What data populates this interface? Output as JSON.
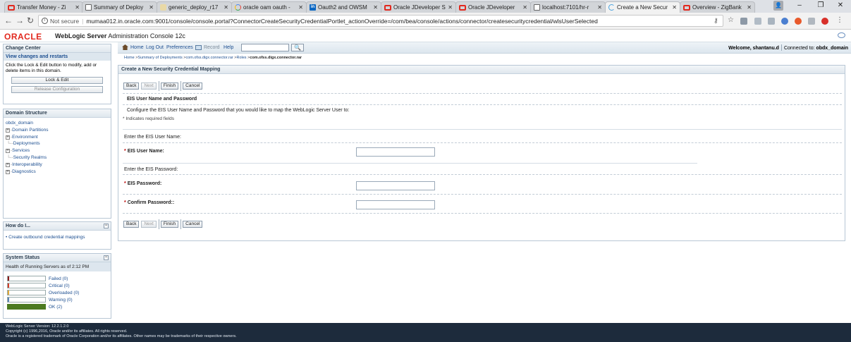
{
  "browser": {
    "tabs": [
      {
        "title": "Transfer Money - Zi",
        "icon": "oracle-icon"
      },
      {
        "title": "Summary of Deploy",
        "icon": "document-icon"
      },
      {
        "title": "generic_deploy_r17",
        "icon": "face-icon"
      },
      {
        "title": "oracle oam oauth -",
        "icon": "google-icon"
      },
      {
        "title": "Oauth2 and OWSM",
        "icon": "linkedin-icon"
      },
      {
        "title": "Oracle JDeveloper S",
        "icon": "oracle-icon"
      },
      {
        "title": "Oracle JDeveloper",
        "icon": "oracle-icon"
      },
      {
        "title": "localhost:7101/hr-r",
        "icon": "document-icon"
      },
      {
        "title": "Create a New Secur",
        "icon": "loading-icon"
      },
      {
        "title": "Overview - ZigBank",
        "icon": "oracle-icon"
      }
    ],
    "security": "Not secure",
    "url": "mumaa012.in.oracle.com:9001/console/console.portal?ConnectorCreateSecurityCredentialPortlet_actionOverride=/com/bea/console/actions/connector/createsecuritycredential/wlsUserSelected"
  },
  "header": {
    "logo": "ORACLE",
    "product": "WebLogic Server",
    "subtitle": "Administration Console 12c"
  },
  "change_center": {
    "title": "Change Center",
    "subtitle": "View changes and restarts",
    "text": "Click the Lock & Edit button to modify, add or delete items in this domain.",
    "lock_edit": "Lock & Edit",
    "release": "Release Configuration"
  },
  "domain_structure": {
    "title": "Domain Structure",
    "root": "obdx_domain",
    "items": [
      {
        "prefix": "⊞",
        "label": "Domain Partitions"
      },
      {
        "prefix": "⊞",
        "label": "Environment"
      },
      {
        "prefix": "",
        "label": "Deployments"
      },
      {
        "prefix": "⊞",
        "label": "Services"
      },
      {
        "prefix": "",
        "label": "Security Realms"
      },
      {
        "prefix": "⊞",
        "label": "Interoperability"
      },
      {
        "prefix": "⊞",
        "label": "Diagnostics"
      }
    ]
  },
  "how_do_i": {
    "title": "How do I...",
    "link": "Create outbound credential mappings"
  },
  "system_status": {
    "title": "System Status",
    "subtitle": "Health of Running Servers as of  2:12 PM",
    "rows": [
      {
        "label": "Failed (0)",
        "color": "#8b1a1a",
        "fill": 0
      },
      {
        "label": "Critical (0)",
        "color": "#d23d2a",
        "fill": 0
      },
      {
        "label": "Overloaded (0)",
        "color": "#e0a83a",
        "fill": 0
      },
      {
        "label": "Warning (0)",
        "color": "#5a83b5",
        "fill": 0
      },
      {
        "label": "OK (2)",
        "color": "#4c7a20",
        "fill": 1
      }
    ]
  },
  "toolbar": {
    "home": "Home",
    "logout": "Log Out",
    "preferences": "Preferences",
    "record": "Record",
    "help": "Help",
    "search_value": "",
    "welcome_prefix": "Welcome, ",
    "user": "shantanu.d",
    "connected_prefix": "Connected to: ",
    "domain": "obdx_domain"
  },
  "breadcrumb": {
    "home": "Home",
    "summary": "Summary of Deployments",
    "rar": "com.ofss.digx.connector.rar",
    "roles": "Roles",
    "current": "com.ofss.digx.connector.rar"
  },
  "content": {
    "title": "Create a New Security Credential Mapping",
    "buttons": {
      "back": "Back",
      "next": "Next",
      "finish": "Finish",
      "cancel": "Cancel"
    },
    "section_title": "EIS User Name and Password",
    "description": "Configure the EIS User Name and Password that you would like to map the WebLogic Server User to:",
    "required_note": "* Indicates required fields",
    "enter_user": "Enter the EIS User Name:",
    "user_label": "EIS User Name:",
    "enter_password": "Enter the EIS Password:",
    "password_label": "EIS Password:",
    "confirm_label": "Confirm Password::"
  },
  "footer": {
    "line1": "WebLogic Server Version: 12.2.1.2.0",
    "line2": "Copyright (c) 1996,2016, Oracle and/or its affiliates. All rights reserved.",
    "line3": "Oracle is a registered trademark of Oracle Corporation and/or its affiliates. Other names may be trademarks of their respective owners."
  }
}
